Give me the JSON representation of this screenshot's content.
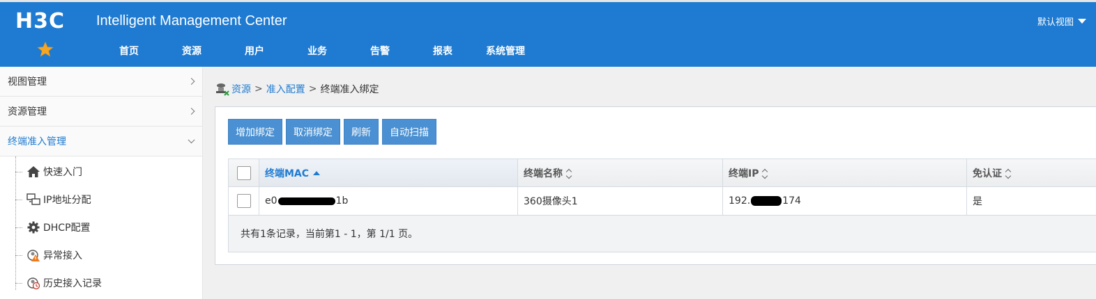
{
  "header": {
    "logo": "H3C",
    "app_title": "Intelligent Management Center",
    "view_switch": "默认视图",
    "nav": [
      "首页",
      "资源",
      "用户",
      "业务",
      "告警",
      "报表",
      "系统管理"
    ]
  },
  "sidebar": {
    "sections": [
      {
        "label": "视图管理",
        "expanded": false
      },
      {
        "label": "资源管理",
        "expanded": false
      },
      {
        "label": "终端准入管理",
        "expanded": true
      }
    ],
    "sub_items": [
      {
        "label": "快速入门",
        "icon": "house-icon"
      },
      {
        "label": "IP地址分配",
        "icon": "network-icon"
      },
      {
        "label": "DHCP配置",
        "icon": "gear-icon"
      },
      {
        "label": "异常接入",
        "icon": "alert-access-icon"
      },
      {
        "label": "历史接入记录",
        "icon": "history-icon"
      }
    ]
  },
  "breadcrumb": {
    "items": [
      "资源",
      "准入配置",
      "终端准入绑定"
    ],
    "separator": ">"
  },
  "toolbar": {
    "add_label": "增加绑定",
    "remove_label": "取消绑定",
    "refresh_label": "刷新",
    "scan_label": "自动扫描"
  },
  "table": {
    "columns": [
      "终端MAC",
      "终端名称",
      "终端IP",
      "免认证"
    ],
    "rows": [
      {
        "mac_start": "e0",
        "mac_end": "1b",
        "name": "360摄像头1",
        "ip_start": "192.",
        "ip_end": "174",
        "exempt": "是"
      }
    ],
    "footer": "共有1条记录，当前第1 - 1，第 1/1 页。"
  },
  "colors": {
    "header_bg": "#1f7bd1",
    "button_bg": "#4a90d2",
    "link": "#1f7bd1",
    "star": "#f5a623"
  }
}
